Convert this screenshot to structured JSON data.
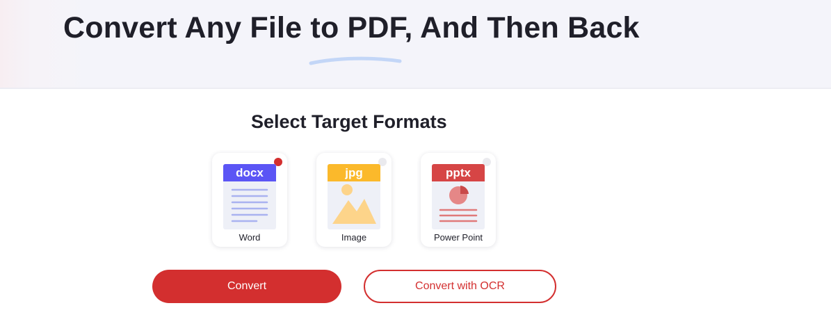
{
  "hero": {
    "title": "Convert Any File to PDF, And Then Back"
  },
  "target": {
    "title": "Select Target Formats",
    "formats": [
      {
        "ext": "docx",
        "label": "Word",
        "selected": true,
        "color": "#5b55f5",
        "icon": "word-doc-icon"
      },
      {
        "ext": "jpg",
        "label": "Image",
        "selected": false,
        "color": "#fbb92b",
        "icon": "image-file-icon"
      },
      {
        "ext": "pptx",
        "label": "Power Point",
        "selected": false,
        "color": "#d64545",
        "icon": "powerpoint-file-icon"
      }
    ]
  },
  "actions": {
    "convert_label": "Convert",
    "ocr_label": "Convert with OCR"
  },
  "colors": {
    "accent": "#d32f2f",
    "word": "#5b55f5",
    "image": "#fbb92b",
    "ppt": "#d64545"
  }
}
